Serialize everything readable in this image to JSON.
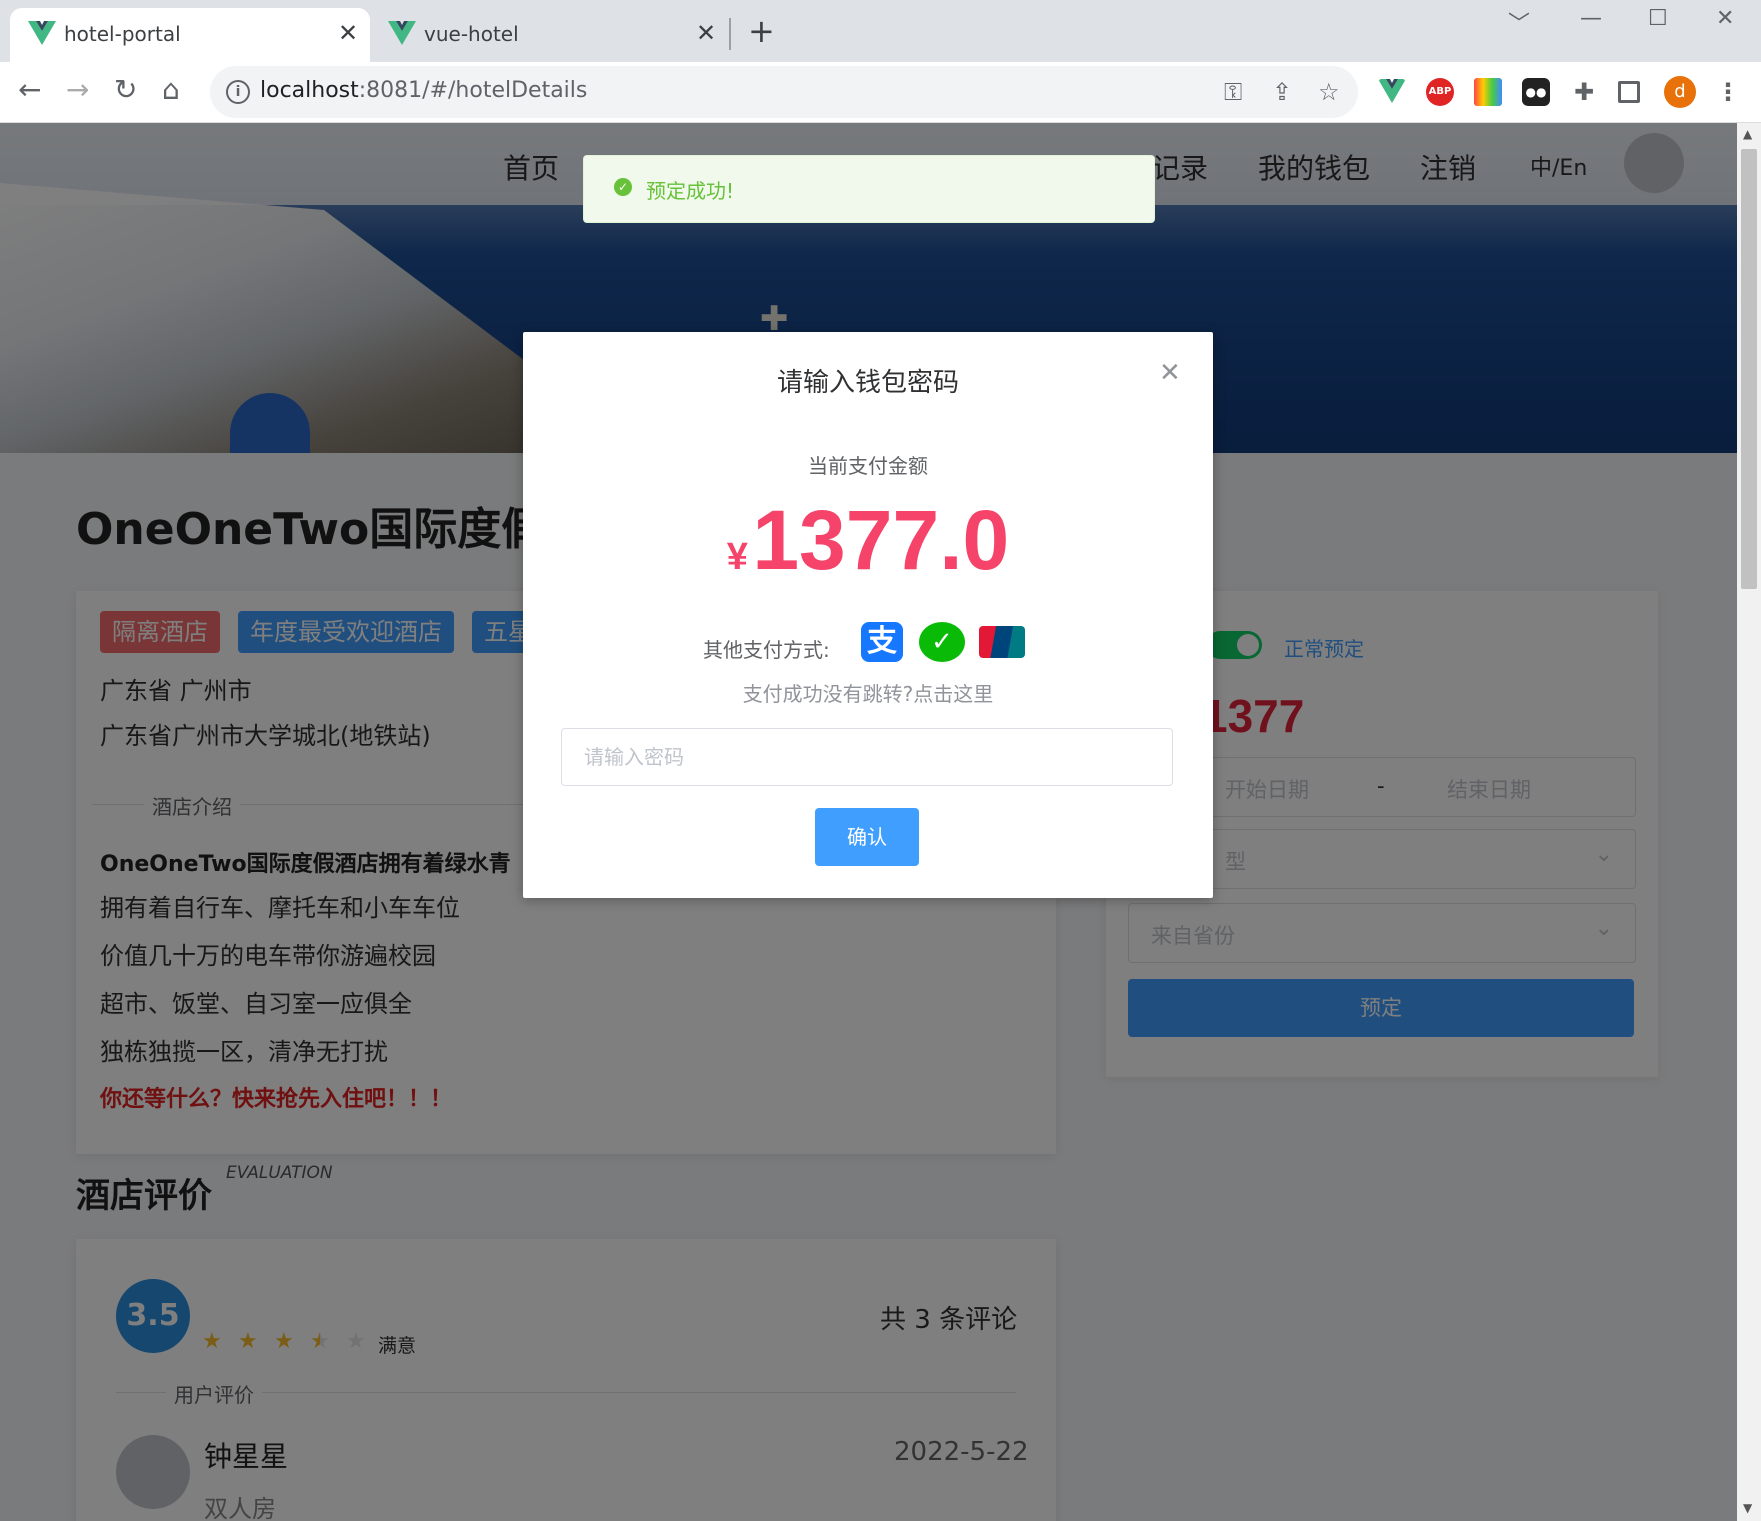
{
  "browser": {
    "tabs": [
      {
        "title": "hotel-portal",
        "close": "✕"
      },
      {
        "title": "vue-hotel",
        "close": "✕"
      }
    ],
    "new_tab": "+",
    "url_host": "localhost",
    "url_rest": ":8081/#/hotelDetails",
    "profile_initial": "d",
    "abp_label": "ABP"
  },
  "nav": {
    "items": [
      "首页",
      "记录",
      "我的钱包",
      "注销"
    ],
    "lang": "中/En"
  },
  "hotel": {
    "title": "OneOneTwo国际度假",
    "tags": [
      "隔离酒店",
      "年度最受欢迎酒店",
      "五星"
    ],
    "province_city": "广东省 广州市",
    "address": "广东省广州市大学城北(地铁站)",
    "intro_label": "酒店介绍",
    "description_bold": "OneOneTwo国际度假酒店拥有着绿水青",
    "description_lines": [
      "拥有着自行车、摩托车和小车车位",
      "价值几十万的电车带你游遍校园",
      "超市、饭堂、自习室一应俱全",
      "独栋独揽一区，清净无打扰"
    ],
    "call_to_action": "你还等什么？快来抢先入住吧！！！"
  },
  "reviews": {
    "title": "酒店评价",
    "subtitle": "EVALUATION",
    "score": "3.5",
    "rating": 3.5,
    "rating_text": "满意",
    "count_text": "共 3 条评论",
    "user_label": "用户评价",
    "items": [
      {
        "name": "钟星星",
        "date": "2022-5-22",
        "room": "双人房"
      }
    ]
  },
  "booking": {
    "switch_label": "正常预定",
    "switch_on": true,
    "price": "1377",
    "start_placeholder": "开始日期",
    "range_sep": "-",
    "end_placeholder": "结束日期",
    "room_type_placeholder": "型",
    "province_placeholder": "来自省份",
    "book_button": "预定"
  },
  "toast": {
    "message": "预定成功!"
  },
  "dialog": {
    "title": "请输入钱包密码",
    "amount_label": "当前支付金额",
    "currency": "¥",
    "amount": "1377.0",
    "other_methods": "其他支付方式:",
    "pay_icons": [
      "alipay-icon",
      "wechat-pay-icon",
      "unionpay-icon"
    ],
    "jump_hint": "支付成功没有跳转?点击这里",
    "password_placeholder": "请输入密码",
    "confirm_button": "确认"
  },
  "colors": {
    "primary": "#409eff",
    "amount": "#f5436a",
    "success": "#67c23a",
    "tag_red": "#f56c6c",
    "tag_blue": "#409eff",
    "price_red": "#e0243c"
  }
}
